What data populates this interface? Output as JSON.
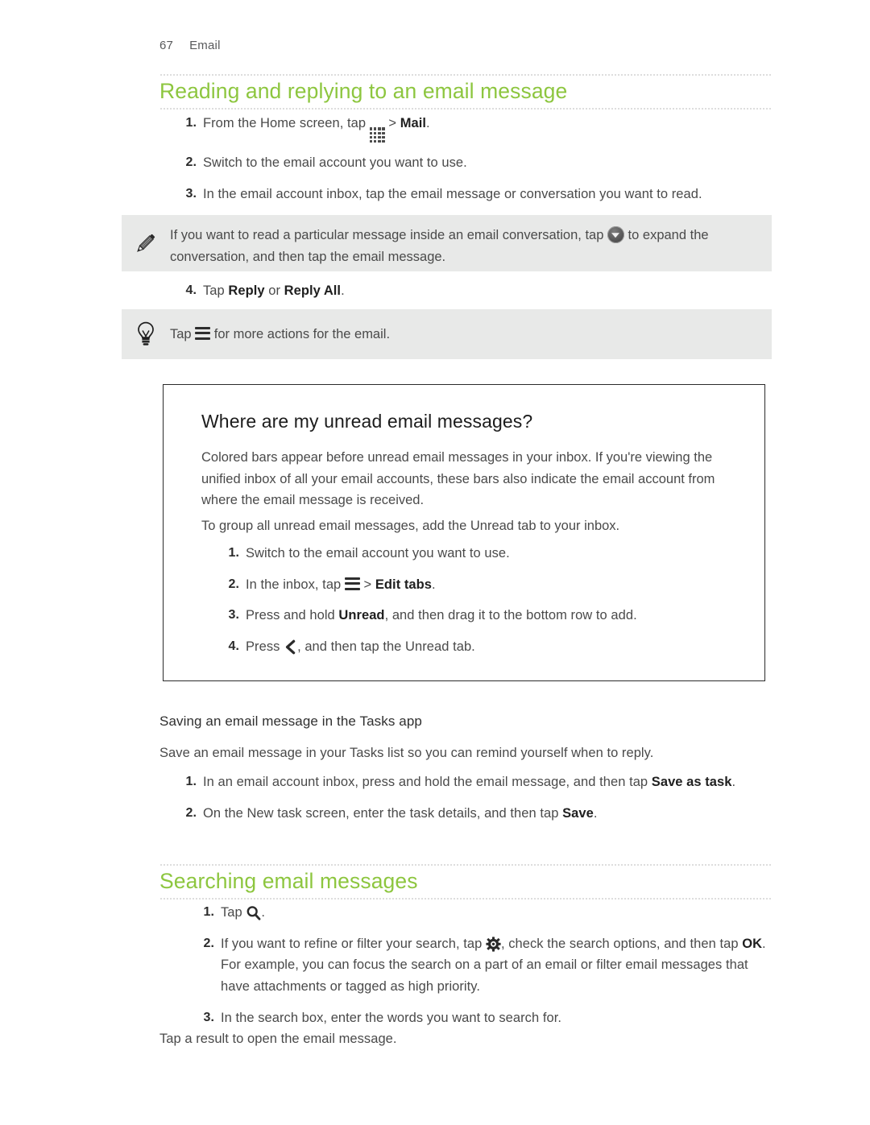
{
  "document": {
    "page_number": "67",
    "chapter": "Email",
    "accent_color": "#8dc63f",
    "note_bg": "#e8e9e8"
  },
  "section1": {
    "heading": "Reading and replying to an email message",
    "steps": [
      {
        "num": "1.",
        "before": "From the Home screen, tap ",
        "icon": "app-grid-icon",
        "after": " > ",
        "bold": "Mail",
        "tail": "."
      },
      {
        "num": "2.",
        "before": "Switch to the email account you want to use.",
        "icon": "",
        "after": "",
        "bold": "",
        "tail": ""
      },
      {
        "num": "3.",
        "before": "In the email account inbox, tap the email message or conversation you want to read.",
        "icon": "",
        "after": "",
        "bold": "",
        "tail": ""
      }
    ],
    "note": {
      "icon": "pencil-icon",
      "before": "If you want to read a particular message inside an email conversation, tap ",
      "icon_inline": "expand-circle-icon",
      "after": " to expand the conversation, and then tap the email message."
    },
    "step4": {
      "num": "4.",
      "before": "Tap ",
      "bold1": "Reply",
      "mid": " or ",
      "bold2": "Reply All",
      "tail": "."
    },
    "tip": {
      "icon": "lightbulb-icon",
      "before": "Tap ",
      "icon_inline": "menu-icon",
      "after": " for more actions for the email."
    }
  },
  "callout": {
    "heading": "Where are my unread email messages?",
    "para1": "Colored bars appear before unread email messages in your inbox. If you're viewing the unified inbox of all your email accounts, these bars also indicate the email account from where the email message is received.",
    "para2": "To group all unread email messages, add the Unread tab to your inbox.",
    "steps": [
      {
        "num": "1.",
        "before": "Switch to the email account you want to use.",
        "icon": "",
        "after": "",
        "bold": "",
        "tail": ""
      },
      {
        "num": "2.",
        "before": "In the inbox, tap ",
        "icon": "menu-icon",
        "after": " > ",
        "bold": "Edit tabs",
        "tail": "."
      },
      {
        "num": "3.",
        "before": "Press and hold ",
        "icon": "",
        "after": "",
        "bold": "Unread",
        "tail": ", and then drag it to the bottom row to add."
      },
      {
        "num": "4.",
        "before": "Press ",
        "icon": "back-chevron-icon",
        "after": ", and then tap the Unread tab.",
        "bold": "",
        "tail": ""
      }
    ]
  },
  "section2": {
    "minor_heading": "Saving an email message in the Tasks app",
    "intro": "Save an email message in your Tasks list so you can remind yourself when to reply.",
    "steps": [
      {
        "num": "1.",
        "before": "In an email account inbox, press and hold the email message, and then tap ",
        "bold": "Save as task",
        "tail": "."
      },
      {
        "num": "2.",
        "before": "On the New task screen, enter the task details, and then tap ",
        "bold": "Save",
        "tail": "."
      }
    ]
  },
  "section3": {
    "heading": "Searching email messages",
    "steps": [
      {
        "num": "1.",
        "before": "Tap ",
        "icon": "search-icon",
        "after": ".",
        "bold": "",
        "tail": ""
      },
      {
        "num": "2.",
        "before": "If you want to refine or filter your search, tap ",
        "icon": "gear-icon",
        "after": ", check the search options, and then tap ",
        "bold": "OK",
        "tail": ". For example, you can focus the search on a part of an email or filter email messages that have attachments or tagged as high priority."
      },
      {
        "num": "3.",
        "before": "In the search box, enter the words you want to search for.",
        "icon": "",
        "after": "",
        "bold": "",
        "tail": ""
      }
    ],
    "closing": "Tap a result to open the email message."
  }
}
